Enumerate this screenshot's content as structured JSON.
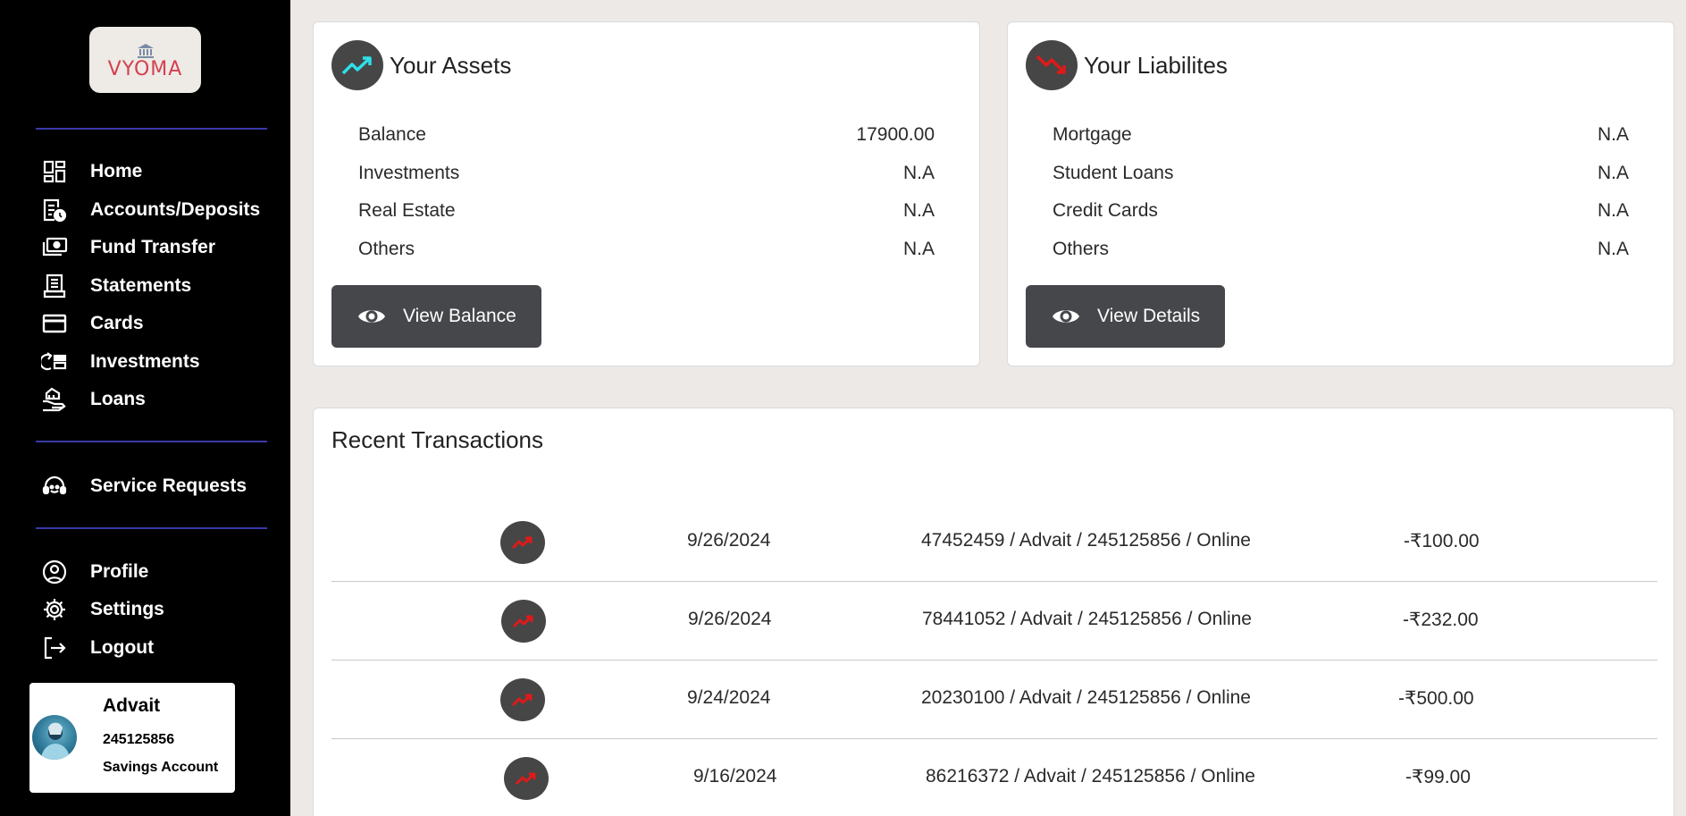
{
  "sidebar": {
    "logo_text": "VYOMA",
    "nav": [
      {
        "label": "Home",
        "icon": "dashboard-icon"
      },
      {
        "label": "Accounts/Deposits",
        "icon": "account-clock-icon"
      },
      {
        "label": "Fund Transfer",
        "icon": "money-transfer-icon"
      },
      {
        "label": "Statements",
        "icon": "receipt-icon"
      },
      {
        "label": "Cards",
        "icon": "credit-card-icon"
      },
      {
        "label": "Investments",
        "icon": "investment-icon"
      },
      {
        "label": "Loans",
        "icon": "loan-hand-icon"
      }
    ],
    "service": {
      "label": "Service Requests",
      "icon": "headset-icon"
    },
    "account_nav": [
      {
        "label": "Profile",
        "icon": "profile-icon"
      },
      {
        "label": "Settings",
        "icon": "gear-icon"
      },
      {
        "label": "Logout",
        "icon": "logout-icon"
      }
    ],
    "user": {
      "name": "Advait",
      "account_number": "245125856",
      "account_type": "Savings Account"
    }
  },
  "assets": {
    "title": "Your Assets",
    "icon": "trending-up-icon",
    "icon_color": "#2ee0e8",
    "items": [
      {
        "label": "Balance",
        "value": "17900.00"
      },
      {
        "label": "Investments",
        "value": "N.A"
      },
      {
        "label": "Real Estate",
        "value": "N.A"
      },
      {
        "label": "Others",
        "value": "N.A"
      }
    ],
    "button": "View Balance"
  },
  "liabilities": {
    "title": "Your Liabilites",
    "icon": "trending-down-icon",
    "icon_color": "#e01919",
    "items": [
      {
        "label": "Mortgage",
        "value": "N.A"
      },
      {
        "label": "Student Loans",
        "value": "N.A"
      },
      {
        "label": "Credit Cards",
        "value": "N.A"
      },
      {
        "label": "Others",
        "value": "N.A"
      }
    ],
    "button": "View Details"
  },
  "transactions": {
    "title": "Recent Transactions",
    "icon_color": "#e01919",
    "rows": [
      {
        "date": "9/26/2024",
        "description": "47452459 / Advait / 245125856 / Online",
        "amount": "-₹100.00"
      },
      {
        "date": "9/26/2024",
        "description": "78441052 / Advait / 245125856 / Online",
        "amount": "-₹232.00"
      },
      {
        "date": "9/24/2024",
        "description": "20230100 / Advait / 245125856 / Online",
        "amount": "-₹500.00"
      },
      {
        "date": "9/16/2024",
        "description": "86216372 / Advait / 245125856 / Online",
        "amount": "-₹99.00"
      }
    ]
  }
}
